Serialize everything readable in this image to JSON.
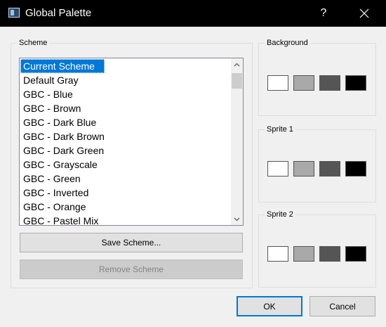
{
  "window": {
    "title": "Global Palette",
    "help_label": "?",
    "icon": "window-app-icon",
    "close_icon": "close-icon"
  },
  "scheme": {
    "group_label": "Scheme",
    "items": [
      "Current Scheme",
      "Default Gray",
      "GBC - Blue",
      "GBC - Brown",
      "GBC - Dark Blue",
      "GBC - Dark Brown",
      "GBC - Dark Green",
      "GBC - Grayscale",
      "GBC - Green",
      "GBC - Inverted",
      "GBC - Orange",
      "GBC - Pastel Mix"
    ],
    "selected": "Current Scheme",
    "save_label": "Save Scheme...",
    "remove_label": "Remove Scheme"
  },
  "palettes": {
    "background": {
      "label": "Background",
      "colors": [
        "#ffffff",
        "#a9a9a9",
        "#555555",
        "#000000"
      ]
    },
    "sprite1": {
      "label": "Sprite 1",
      "colors": [
        "#ffffff",
        "#a9a9a9",
        "#555555",
        "#000000"
      ]
    },
    "sprite2": {
      "label": "Sprite 2",
      "colors": [
        "#ffffff",
        "#a9a9a9",
        "#555555",
        "#000000"
      ]
    }
  },
  "buttons": {
    "ok_label": "OK",
    "cancel_label": "Cancel"
  },
  "colors": {
    "accent": "#0078d7",
    "titlebar": "#000000",
    "dialog_bg": "#f0f0f0"
  }
}
